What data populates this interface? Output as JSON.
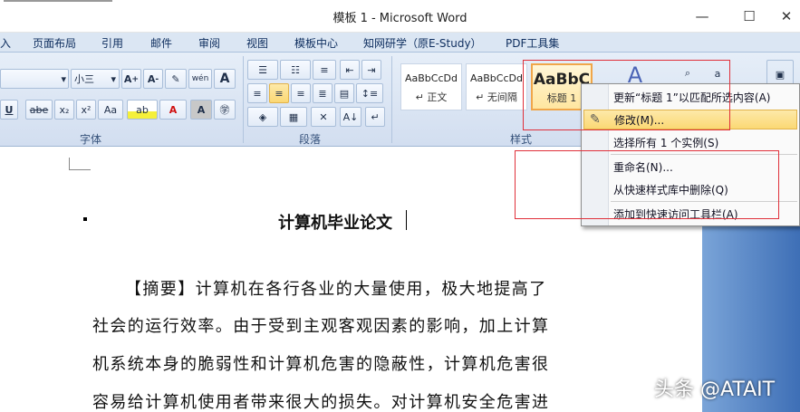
{
  "window": {
    "title": "模板 1 - Microsoft Word",
    "buttons": [
      "—",
      "☐",
      "✕"
    ]
  },
  "menu": [
    "入",
    "页面布局",
    "引用",
    "邮件",
    "审阅",
    "视图",
    "模板中心",
    "知网研学（原E-Study）",
    "PDF工具集"
  ],
  "ribbon": {
    "font_size": "小三",
    "font_group": "字体",
    "para_group": "段落",
    "styles_group": "样式",
    "styles": [
      {
        "sample": "AaBbCcDd",
        "name": "↵ 正文"
      },
      {
        "sample": "AaBbCcDd",
        "name": "↵ 无间隔"
      },
      {
        "sample": "AaBbC",
        "name": "标题 1"
      }
    ],
    "font_buttons": [
      "U",
      "abe",
      "x₂",
      "x²",
      "Aa"
    ]
  },
  "context_menu": {
    "items": [
      {
        "label": "更新“标题 1”以匹配所选内容(A)"
      },
      {
        "label": "修改(M)..."
      },
      {
        "label": "选择所有 1 个实例(S)"
      },
      {
        "label": "重命名(N)..."
      },
      {
        "label": "从快速样式库中删除(Q)"
      },
      {
        "label": "添加到快速访问工具栏(A)"
      }
    ]
  },
  "document": {
    "title": "计算机毕业论文",
    "lines": [
      "【摘要】计算机在各行各业的大量使用，极大地提高了",
      "社会的运行效率。由于受到主观客观因素的影响，加上计算",
      "机系统本身的脆弱性和计算机危害的隐蔽性，计算机危害很",
      "容易给计算机使用者带来很大的损失。对计算机安全危害进"
    ]
  },
  "watermark": "头条 @ATAIT"
}
